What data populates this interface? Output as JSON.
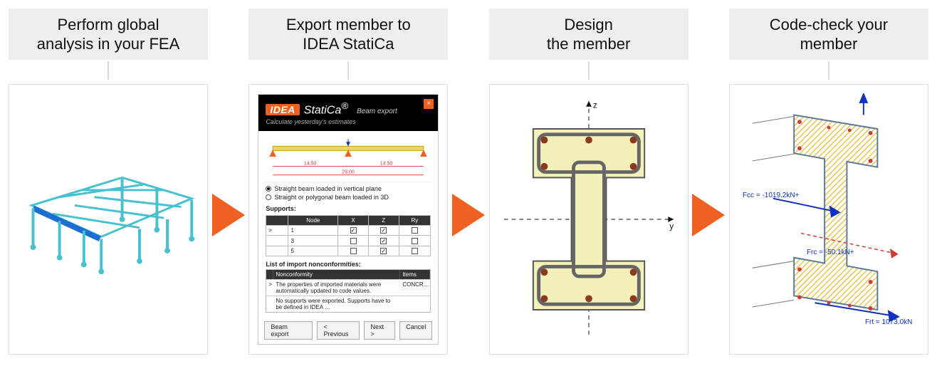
{
  "colors": {
    "accent": "#ee6122",
    "fea_blue": "#1e6ed2",
    "fea_teal": "#46c1cf",
    "force_blue": "#1030c0",
    "force_red": "#d23a3a",
    "section_fill": "#f3f0b8",
    "rebar": "#8a3b1f"
  },
  "steps": [
    {
      "title": "Perform global\nanalysis in your FEA"
    },
    {
      "title": "Export member to\nIDEA StatiCa"
    },
    {
      "title": "Design\nthe member"
    },
    {
      "title": "Code-check your\nmember"
    }
  ],
  "export_dialog": {
    "brand": {
      "idea": "IDEA",
      "name": "StatiCa",
      "reg": "®",
      "module": "Beam export",
      "tagline": "Calculate yesterday's estimates"
    },
    "close": "×",
    "spans": {
      "a": "14.50",
      "b": "14.50",
      "total": "29.00"
    },
    "radios": [
      {
        "label": "Straight beam loaded in vertical plane",
        "selected": true
      },
      {
        "label": "Straight or polygonal beam loaded in 3D",
        "selected": false
      }
    ],
    "supports_title": "Supports:",
    "supports": {
      "headers": [
        "",
        "Node",
        "X",
        "Z",
        "Ry"
      ],
      "rows": [
        {
          "lead": ">",
          "node": "1",
          "x": true,
          "z": true,
          "ry": false
        },
        {
          "lead": "",
          "node": "3",
          "x": false,
          "z": true,
          "ry": false
        },
        {
          "lead": "",
          "node": "5",
          "x": false,
          "z": true,
          "ry": false
        }
      ]
    },
    "nonconf_title": "List of import nonconformities:",
    "nonconf": {
      "headers": [
        "",
        "Nonconformity",
        "Items"
      ],
      "rows": [
        {
          "lead": ">",
          "text": "The properties of imported materials were automatically updated to code values.",
          "item": "CONCR…"
        },
        {
          "lead": "",
          "text": "No supports were exported. Supports have to be defined in IDEA …",
          "item": ""
        }
      ]
    },
    "buttons": [
      "Beam export",
      "< Previous",
      "Next >",
      "Cancel"
    ]
  },
  "section": {
    "axis_y": "y",
    "axis_z": "z"
  },
  "code_check": {
    "labels": {
      "Fcc": "Fcc = -1019.2kN+",
      "Frc": "Frc = -50.1kN+",
      "Frt": "Frt = 1073.0kN"
    }
  }
}
